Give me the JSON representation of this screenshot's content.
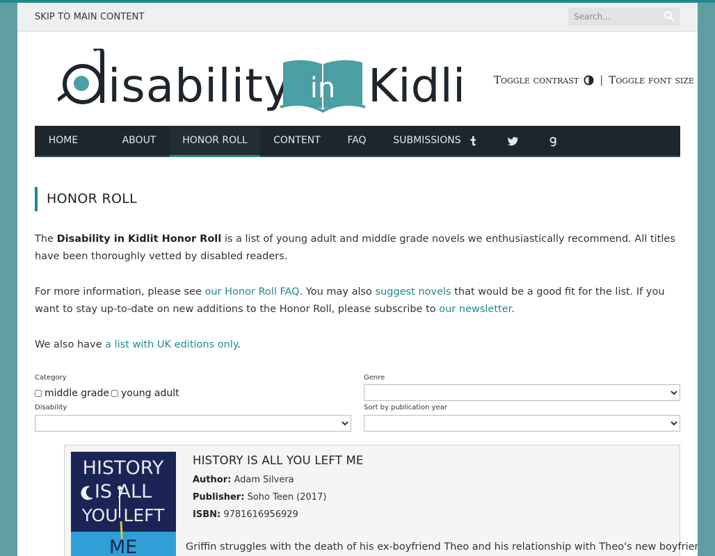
{
  "topbar": {
    "skip_link": "Skip to main content",
    "search_placeholder": "Search..."
  },
  "header": {
    "logo": {
      "text_prefix": "isability",
      "text_middle": "in",
      "text_suffix": "Kidlit",
      "colors": {
        "dark": "#1d262d",
        "accent": "#4a9fa4"
      }
    },
    "toggle_contrast": "Toggle contrast",
    "separator": "|",
    "toggle_font_size": "Toggle font size"
  },
  "nav": {
    "items": [
      {
        "label": "Home"
      },
      {
        "label": "About"
      },
      {
        "label": "Honor Roll",
        "active": true
      },
      {
        "label": "Content"
      },
      {
        "label": "FAQ"
      },
      {
        "label": "Submissions"
      }
    ],
    "icons": [
      "tumblr-icon",
      "twitter-icon",
      "goodreads-icon"
    ],
    "colors": {
      "background": "#1d262d",
      "accent": "#1f8a8c"
    }
  },
  "page": {
    "title": "Honor Roll",
    "p1": {
      "t1": "The ",
      "bold": "Disability in Kidlit Honor Roll",
      "t2": " is a list of young adult and middle grade novels we enthusiastically recommend. All titles have been thoroughly vetted by disabled readers."
    },
    "p2": {
      "t1": "For more information, please see ",
      "link1": "our Honor Roll FAQ",
      "t2": ". You may also ",
      "link2": "suggest novels",
      "t3": " that would be a good fit for the list. If you want to stay up-to-date on new additions to the Honor Roll, please subscribe to ",
      "link3": "our newsletter",
      "t4": "."
    },
    "p3": {
      "t1": "We also have ",
      "link1": "a list with UK editions only",
      "t2": "."
    }
  },
  "filters": {
    "category_label": "Category",
    "category_options": [
      "middle grade",
      "young adult"
    ],
    "genre_label": "Genre",
    "disability_label": "Disability",
    "sort_label": "Sort by publication year"
  },
  "book": {
    "cover_text": [
      "HISTORY",
      "IS ALL",
      "YOU LEFT",
      "ME"
    ],
    "title": "History Is All You Left Me",
    "author_label": "Author:",
    "author": "Adam Silvera",
    "publisher_label": "Publisher:",
    "publisher": "Soho Teen (2017)",
    "isbn_label": "ISBN:",
    "isbn": "9781616956929",
    "description": "Griffin struggles with the death of his ex-boyfriend Theo and his relationship with Theo's new boyfriend"
  }
}
